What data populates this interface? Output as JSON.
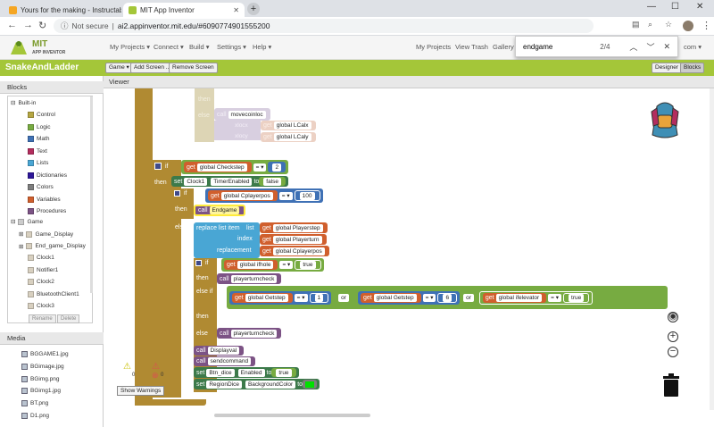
{
  "browser": {
    "tabs": [
      {
        "title": "Yours for the making - Instructab",
        "active": false
      },
      {
        "title": "MIT App Inventor",
        "active": true
      }
    ],
    "new_tab": "+",
    "window_controls": [
      "—",
      "☐",
      "✕"
    ],
    "security_label": "Not secure",
    "url": "ai2.appinventor.mit.edu/#6090774901555200"
  },
  "find": {
    "query": "endgame",
    "count": "2/4"
  },
  "header": {
    "logo_line1": "MIT",
    "logo_line2": "APP INVENTOR",
    "menus": [
      "My Projects ▾",
      "Connect ▾",
      "Build ▾",
      "Settings ▾",
      "Help ▾"
    ],
    "right_links": [
      "My Projects",
      "View Trash",
      "Gallery"
    ],
    "account_suffix": "com ▾"
  },
  "project": {
    "name": "SnakeAndLadder",
    "buttons": [
      "Game ▾",
      "Add Screen ...",
      "Remove Screen"
    ],
    "view_buttons": [
      "Designer",
      "Blocks"
    ]
  },
  "blocks_panel": {
    "title": "Blocks",
    "builtin_label": "Built-in",
    "builtin": [
      {
        "label": "Control",
        "color": "#b5a642"
      },
      {
        "label": "Logic",
        "color": "#77ab41"
      },
      {
        "label": "Math",
        "color": "#3f71b5"
      },
      {
        "label": "Text",
        "color": "#b32d5e"
      },
      {
        "label": "Lists",
        "color": "#49a6d4"
      },
      {
        "label": "Dictionaries",
        "color": "#2d1799"
      },
      {
        "label": "Colors",
        "color": "#7d7d7d"
      },
      {
        "label": "Variables",
        "color": "#d05f2d"
      },
      {
        "label": "Procedures",
        "color": "#7c5385"
      }
    ],
    "game_label": "Game",
    "components": [
      "Game_Display",
      "End_game_Display",
      "Clock1",
      "Notifier1",
      "Clock2",
      "BluetoothClient1",
      "Clock3"
    ],
    "rename": "Rename",
    "delete": "Delete"
  },
  "media": {
    "title": "Media",
    "files": [
      "BGGAME1.jpg",
      "BGimage.jpg",
      "BGimg.png",
      "BGimg1.jpg",
      "BT.png",
      "D1.png"
    ]
  },
  "viewer": {
    "title": "Viewer",
    "warn_count": "0",
    "error_count": "0",
    "show_warnings": "Show Warnings"
  },
  "code": {
    "then": "then",
    "else": "else",
    "call": "call",
    "movecoinloc": "movecoinloc",
    "xlbl": "xlocx",
    "ylbl": "xlocy",
    "lcalx": "global LCalx",
    "lcaly": "global LCaly",
    "get": "get",
    "if": "if",
    "set": "set",
    "to": "to",
    "checkstep": "global Checkstep",
    "eq": "= ▾",
    "two": "2",
    "clock1": "Clock1",
    "timerenabled": "TimerEnabled",
    "false": "false",
    "cplayerpos": "global Cplayerpos",
    "hundred": "100",
    "endgame": "Endgame",
    "replace": "replace list item",
    "list": "list",
    "index": "index",
    "replacement": "replacement",
    "playerstep": "global Playerstep",
    "playerturn": "global Playerturn",
    "ifhole": "global ifhole",
    "true": "true",
    "playerturncheck": "playerturncheck",
    "elseif": "else if",
    "getstep": "global Getstep",
    "one": "1",
    "or": "or",
    "six": "6",
    "ifelevator": "global ifelevator",
    "displayval": "Displayval",
    "sendcommand": "sendcommand",
    "btn_dice": "Btn_dice",
    "enabled": "Enabled",
    "regiondice": "RegionDice",
    "bgcolor": "BackgroundColor"
  }
}
